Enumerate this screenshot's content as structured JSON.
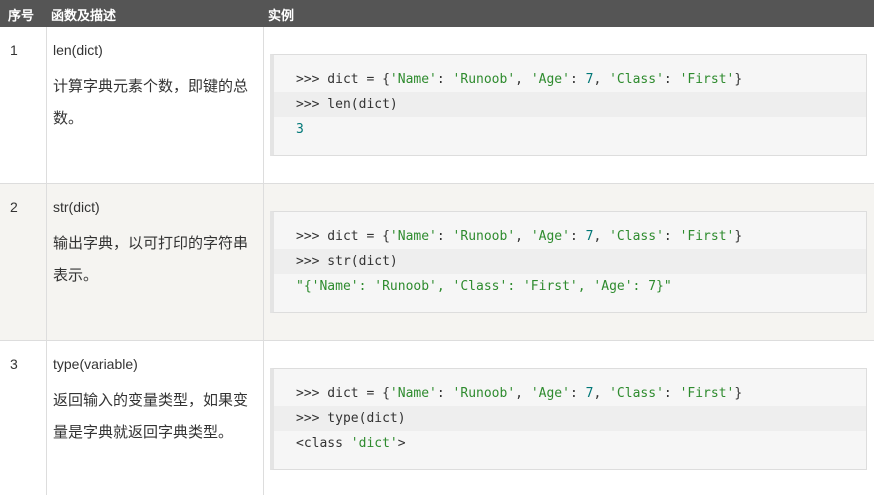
{
  "header": {
    "col_index": "序号",
    "col_func": "函数及描述",
    "col_example": "实例"
  },
  "rows": [
    {
      "index": "1",
      "func": "len(dict)",
      "desc": "计算字典元素个数，即键的总数。",
      "code": [
        ">>> dict = {'Name': 'Runoob', 'Age': 7, 'Class': 'First'}",
        ">>> len(dict)",
        "3"
      ]
    },
    {
      "index": "2",
      "func": "str(dict)",
      "desc": "输出字典，以可打印的字符串表示。",
      "code": [
        ">>> dict = {'Name': 'Runoob', 'Age': 7, 'Class': 'First'}",
        ">>> str(dict)",
        "\"{'Name': 'Runoob', 'Class': 'First', 'Age': 7}\""
      ]
    },
    {
      "index": "3",
      "func": "type(variable)",
      "desc": "返回输入的变量类型，如果变量是字典就返回字典类型。",
      "code": [
        ">>> dict = {'Name': 'Runoob', 'Age': 7, 'Class': 'First'}",
        ">>> type(dict)",
        "<class 'dict'>"
      ]
    }
  ]
}
